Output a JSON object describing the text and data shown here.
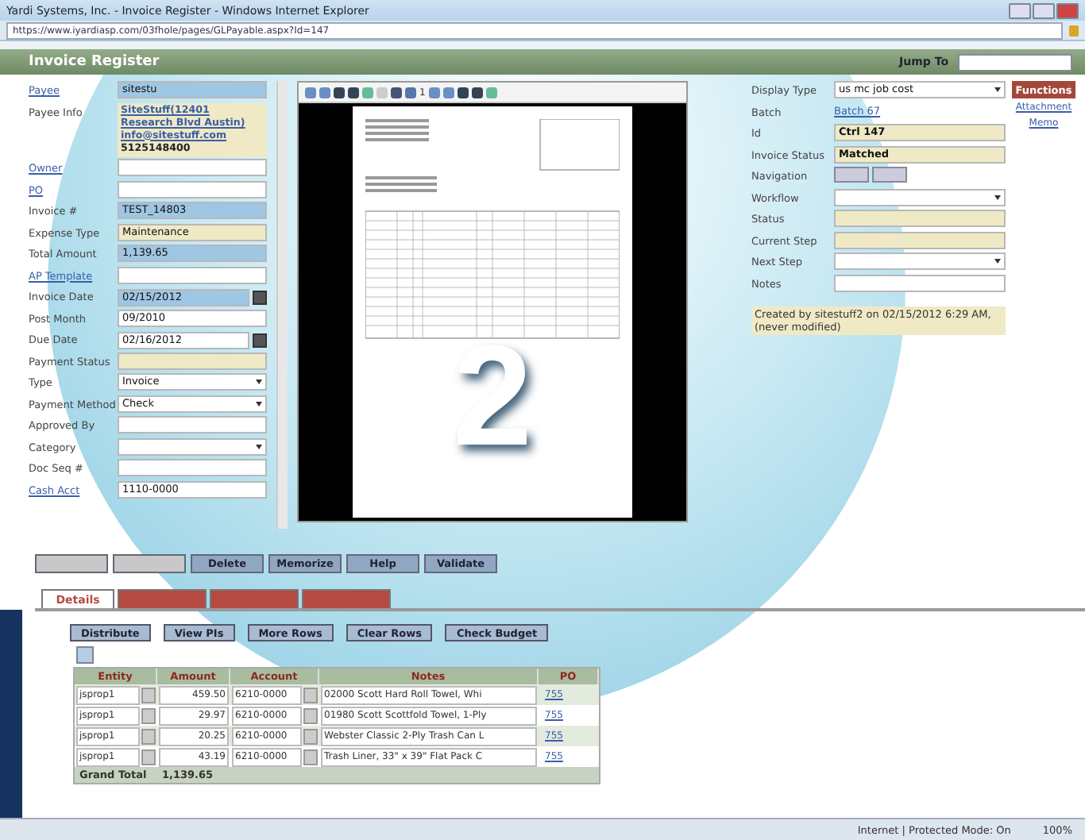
{
  "window": {
    "title": "Yardi Systems, Inc. - Invoice Register - Windows Internet Explorer",
    "address": "https://www.iyardiasp.com/03fhole/pages/GLPayable.aspx?Id=147"
  },
  "header": {
    "title": "Invoice Register",
    "jump_to_label": "Jump To"
  },
  "left_form": [
    {
      "label": "Payee",
      "link": true,
      "kind": "input",
      "required": true,
      "readonly": false,
      "value": "sitestu"
    },
    {
      "label": "Payee Info",
      "link": false,
      "kind": "info",
      "lines": [
        "SiteStuff(12401",
        "Research Blvd Austin)",
        "info@sitestuff.com",
        "5125148400"
      ]
    },
    {
      "label": "Owner",
      "link": true,
      "kind": "input",
      "required": false,
      "readonly": false
    },
    {
      "label": "PO",
      "link": true,
      "kind": "input",
      "required": false,
      "readonly": false
    },
    {
      "label": "Invoice #",
      "link": false,
      "kind": "input",
      "required": true,
      "readonly": false,
      "value": "TEST_14803"
    },
    {
      "label": "Expense Type",
      "link": false,
      "kind": "input",
      "required": false,
      "readonly": true,
      "value": "Maintenance"
    },
    {
      "label": "Total Amount",
      "link": false,
      "kind": "input",
      "required": true,
      "readonly": false,
      "value": "1,139.65"
    },
    {
      "label": "AP Template",
      "link": true,
      "kind": "input",
      "required": false,
      "readonly": false
    },
    {
      "label": "Invoice Date",
      "link": false,
      "kind": "date",
      "required": true,
      "readonly": false,
      "value": "02/15/2012"
    },
    {
      "label": "Post Month",
      "link": false,
      "kind": "input",
      "required": false,
      "readonly": false,
      "value": "09/2010"
    },
    {
      "label": "Due Date",
      "link": false,
      "kind": "date",
      "required": false,
      "readonly": false,
      "value": "02/16/2012"
    },
    {
      "label": "Payment Status",
      "link": false,
      "kind": "input",
      "required": false,
      "readonly": true
    },
    {
      "label": "Type",
      "link": false,
      "kind": "select",
      "required": false,
      "readonly": false,
      "value": "Invoice"
    },
    {
      "label": "Payment Method",
      "link": false,
      "kind": "select",
      "required": false,
      "readonly": false,
      "value": "Check"
    },
    {
      "label": "Approved By",
      "link": false,
      "kind": "input",
      "required": false,
      "readonly": false
    },
    {
      "label": "Category",
      "link": false,
      "kind": "select",
      "required": false,
      "readonly": false
    },
    {
      "label": "Doc Seq #",
      "link": false,
      "kind": "input",
      "required": false,
      "readonly": false
    },
    {
      "label": "Cash Acct",
      "link": true,
      "kind": "input",
      "required": false,
      "readonly": false,
      "value": "1110-0000"
    }
  ],
  "viewer": {
    "page_number": "1"
  },
  "right_form": [
    {
      "label": "Display Type",
      "kind": "select",
      "readonly": false,
      "value": "us mc job cost"
    },
    {
      "label": "Batch",
      "kind": "link",
      "value": "Batch 67"
    },
    {
      "label": "Id",
      "kind": "input",
      "readonly": true,
      "value": "Ctrl 147"
    },
    {
      "label": "Invoice Status",
      "kind": "input",
      "readonly": true,
      "value": "Matched"
    },
    {
      "label": "Navigation",
      "kind": "nav"
    },
    {
      "label": "Workflow",
      "kind": "select",
      "readonly": false
    },
    {
      "label": "Status",
      "kind": "input",
      "readonly": true
    },
    {
      "label": "Current Step",
      "kind": "input",
      "readonly": true
    },
    {
      "label": "Next Step",
      "kind": "select",
      "readonly": false
    },
    {
      "label": "Notes",
      "kind": "input",
      "readonly": false
    }
  ],
  "created_note": "Created by sitestuff2 on 02/15/2012 6:29 AM, (never modified)",
  "side_menu": {
    "functions": "Functions",
    "links": [
      "Attachment",
      "Memo"
    ]
  },
  "action_buttons": [
    {
      "disabled": true
    },
    {
      "disabled": true
    },
    {
      "label": "Delete",
      "disabled": false
    },
    {
      "label": "Memorize",
      "disabled": false
    },
    {
      "label": "Help",
      "disabled": false
    },
    {
      "label": "Validate",
      "disabled": false
    }
  ],
  "tabs": [
    {
      "label": "Details",
      "selected": true
    },
    {
      "selected": false
    },
    {
      "selected": false
    },
    {
      "selected": false
    }
  ],
  "detail_buttons": [
    "Distribute",
    "View PIs",
    "More Rows",
    "Clear Rows",
    "Check Budget"
  ],
  "table": {
    "columns": [
      "Entity",
      "Amount",
      "Account",
      "Notes",
      "PO"
    ],
    "rows": [
      {
        "entity": "jsprop1",
        "amount": "459.50",
        "account": "6210-0000",
        "notes": "02000 Scott Hard Roll Towel, Whi",
        "po": "755"
      },
      {
        "entity": "jsprop1",
        "amount": "29.97",
        "account": "6210-0000",
        "notes": "01980 Scott Scottfold Towel, 1-Ply",
        "po": "755"
      },
      {
        "entity": "jsprop1",
        "amount": "20.25",
        "account": "6210-0000",
        "notes": "Webster Classic 2-Ply Trash Can L",
        "po": "755"
      },
      {
        "entity": "jsprop1",
        "amount": "43.19",
        "account": "6210-0000",
        "notes": "Trash Liner, 33\" x 39\" Flat Pack C",
        "po": "755"
      }
    ],
    "total_label": "Grand Total",
    "total_amount": "1,139.65"
  },
  "status_bar": {
    "zone": "Internet | Protected Mode: On",
    "zoom": "100%"
  },
  "overlay_number": "2"
}
